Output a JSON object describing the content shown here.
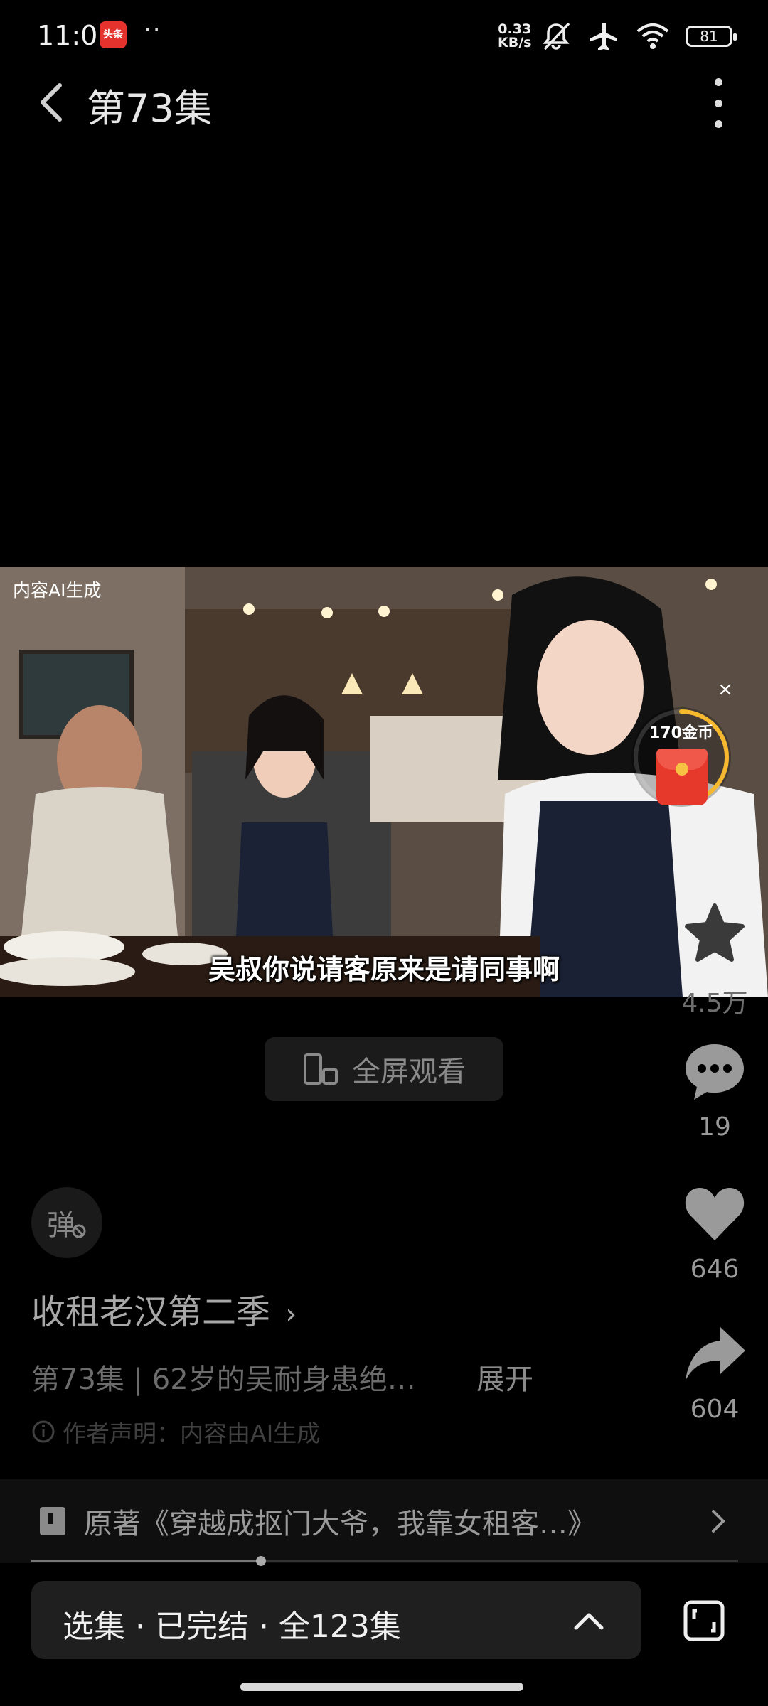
{
  "status_bar": {
    "time": "11:01",
    "app_badge": "头条",
    "dots": "··",
    "net_speed_value": "0.33",
    "net_speed_unit": "KB/s",
    "battery": "81",
    "icons": [
      "mute-icon",
      "airplane-icon",
      "wifi-icon",
      "battery-icon"
    ]
  },
  "header": {
    "title": "第73集",
    "back_icon": "chevron-left-icon",
    "more_icon": "more-vertical-icon"
  },
  "video": {
    "ai_label": "内容AI生成",
    "subtitle": "吴叔你说请客原来是请同事啊"
  },
  "coin_widget": {
    "label": "170金币",
    "close": "×",
    "progress": 0.45,
    "accent": "#f5b82e"
  },
  "rail": {
    "favorite_count": "4.5万",
    "comment_count": "19",
    "like_count": "646",
    "share_count": "604"
  },
  "fullscreen": {
    "label": "全屏观看"
  },
  "danmaku": {
    "label": "弹"
  },
  "drama": {
    "title": "收租老汉第二季",
    "title_arrow": "›",
    "description": "第73集 | 62岁的吴耐身患绝…",
    "expand": "展开",
    "author_note": "作者声明：内容由AI生成"
  },
  "novel": {
    "text": "原著《穿越成抠门大爷，我靠女租客…》"
  },
  "playback": {
    "progress": 0.325
  },
  "episodes": {
    "label": "选集 · 已完结 · 全123集"
  },
  "colors": {
    "background": "#000000",
    "coin_ring": "#f5b82e",
    "envelope": "#e6392c"
  }
}
